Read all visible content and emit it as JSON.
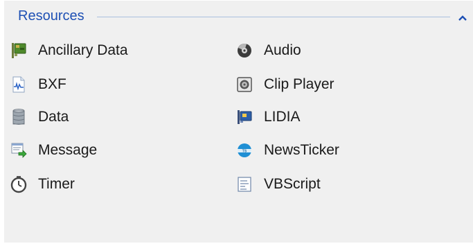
{
  "section": {
    "title": "Resources",
    "collapse_icon": "chevron-up-icon"
  },
  "items": [
    {
      "label": "Ancillary Data",
      "icon": "ancillary-data-icon"
    },
    {
      "label": "Audio",
      "icon": "audio-icon"
    },
    {
      "label": "BXF",
      "icon": "bxf-icon"
    },
    {
      "label": "Clip Player",
      "icon": "clip-player-icon"
    },
    {
      "label": "Data",
      "icon": "data-icon"
    },
    {
      "label": "LIDIA",
      "icon": "lidia-icon"
    },
    {
      "label": "Message",
      "icon": "message-icon"
    },
    {
      "label": "NewsTicker",
      "icon": "newsticker-icon"
    },
    {
      "label": "Timer",
      "icon": "timer-icon"
    },
    {
      "label": "VBScript",
      "icon": "vbscript-icon"
    }
  ],
  "colors": {
    "header_text": "#1e50b4",
    "header_rule": "#a9bfde",
    "panel_bg": "#f0f0f0"
  }
}
